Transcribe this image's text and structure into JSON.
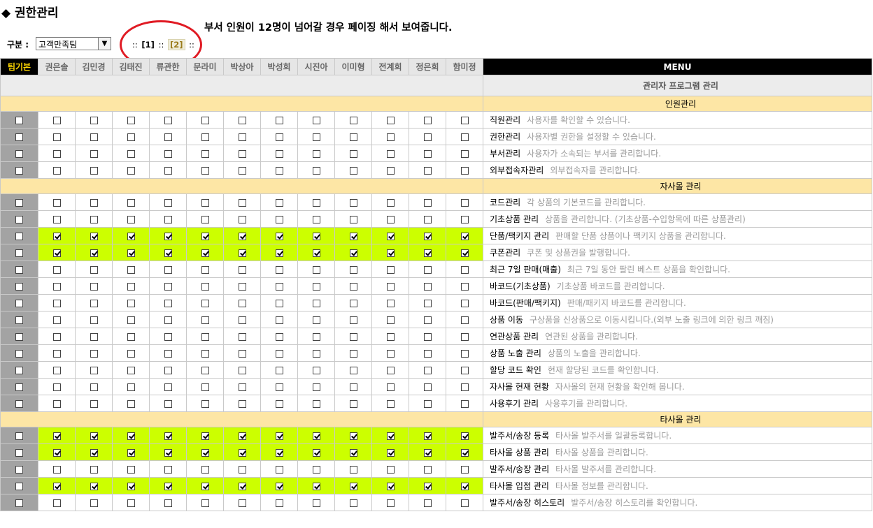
{
  "page": {
    "title": "◆ 권한관리",
    "notice": "부서 인원이 12명이 넘어갈 경우 페이징 해서 보여줍니다.",
    "gubun_label": "구분 :",
    "gubun_value": "고객만족팀",
    "paging": {
      "sep": "::",
      "page1": "[1]",
      "page2": "[2]"
    }
  },
  "columns": [
    "팀기본",
    "권은솔",
    "김민경",
    "김태진",
    "류관한",
    "문라미",
    "박상아",
    "박성희",
    "시진아",
    "이미형",
    "전계희",
    "정은희",
    "함미정"
  ],
  "menu_header": "MENU",
  "admin_row": "관리자 프로그램 관리",
  "sections": [
    {
      "title": "인원관리",
      "rows": [
        {
          "name": "직원관리",
          "desc": "사용자를 확인할 수 있습니다.",
          "checked": false
        },
        {
          "name": "권한관리",
          "desc": "사용자별 권한을 설정할 수 있습니다.",
          "checked": false
        },
        {
          "name": "부서관리",
          "desc": "사용자가 소속되는 부서를 관리합니다.",
          "checked": false
        },
        {
          "name": "외부접속자관리",
          "desc": "외부접속자를 관리합니다.",
          "checked": false
        }
      ]
    },
    {
      "title": "자사몰 관리",
      "rows": [
        {
          "name": "코드관리",
          "desc": "각 상품의 기본코드를 관리합니다.",
          "checked": false
        },
        {
          "name": "기초상품 관리",
          "desc": "상품을 관리합니다. (기초상품-수입항목에 따른 상품관리)",
          "checked": false
        },
        {
          "name": "단품/팩키지 관리",
          "desc": "판매할 단품 상품이나 팩키지 상품을 관리합니다.",
          "checked": true
        },
        {
          "name": "쿠폰관리",
          "desc": "쿠폰 및 상품권을 발행합니다.",
          "checked": true
        },
        {
          "name": "최근 7일 판매(매출)",
          "desc": "최근 7일 동안 팔린 베스트 상품을 확인합니다.",
          "checked": false
        },
        {
          "name": "바코드(기초상품)",
          "desc": "기초상품 바코드를 관리합니다.",
          "checked": false
        },
        {
          "name": "바코드(판매/팩키지)",
          "desc": "판매/패키지 바코드를 관리합니다.",
          "checked": false
        },
        {
          "name": "상품 이동",
          "desc": "구상품을 신상품으로 이동시킵니다.(외부 노출 링크에 의한 링크 깨짐)",
          "checked": false
        },
        {
          "name": "연관상품 관리",
          "desc": "연관된 상품을 관리합니다.",
          "checked": false
        },
        {
          "name": "상품 노출 관리",
          "desc": "상품의 노출을 관리합니다.",
          "checked": false
        },
        {
          "name": "할당 코드 확인",
          "desc": "현재 할당된 코드를 확인합니다.",
          "checked": false
        },
        {
          "name": "자사몰 현재 현황",
          "desc": "자사몰의 현재 현황을 확인해 봅니다.",
          "checked": false
        },
        {
          "name": "사용후기 관리",
          "desc": "사용후기를 관리합니다.",
          "checked": false
        }
      ]
    },
    {
      "title": "타사몰 관리",
      "rows": [
        {
          "name": "발주서/송장 등록",
          "desc": "타사몰 발주서를 일괄등록합니다.",
          "checked": true
        },
        {
          "name": "타사몰 상품 관리",
          "desc": "타사몰 상품을 관리합니다.",
          "checked": true
        },
        {
          "name": "발주서/송장 관리",
          "desc": "타사몰 발주서를 관리합니다.",
          "checked": false
        },
        {
          "name": "타사몰 입점 관리",
          "desc": "타사몰 정보를 관리합니다.",
          "checked": true
        },
        {
          "name": "발주서/송장 히스토리",
          "desc": "발주서/송장 히스토리를 확인합니다.",
          "checked": false
        }
      ]
    }
  ],
  "colors": {
    "checked_row": "#ccff00",
    "section_bg": "#fde6a5",
    "team_col": "#a3a3a3",
    "annotation_circle": "#e01b24"
  }
}
